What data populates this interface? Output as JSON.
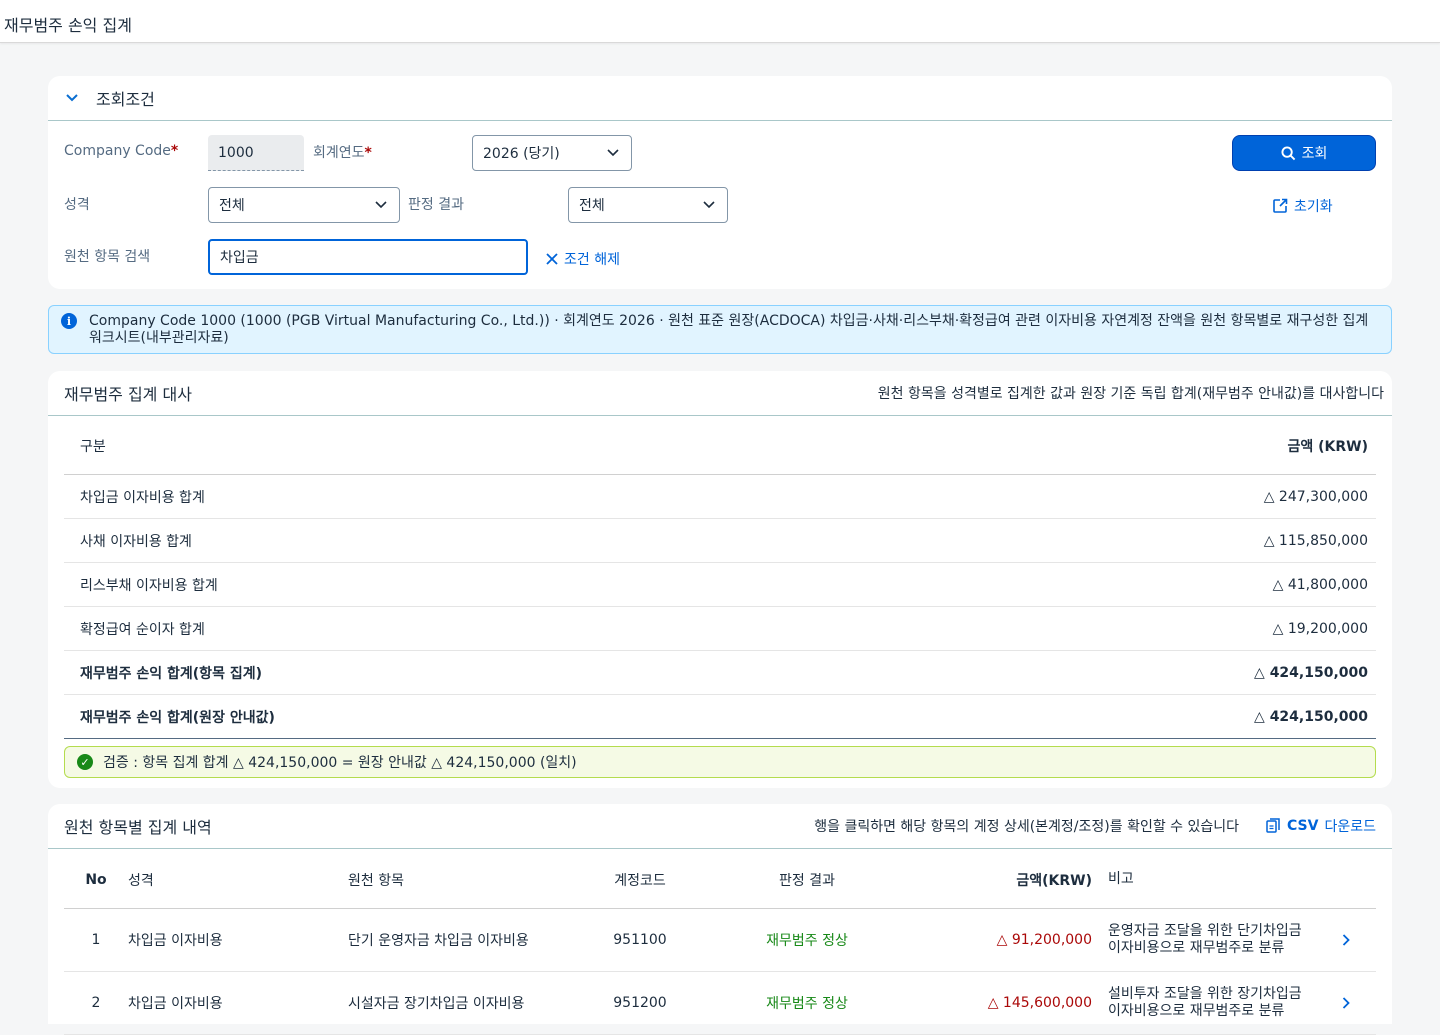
{
  "page": {
    "title": "재무범주 손익 집계"
  },
  "filter": {
    "title": "조회조건",
    "company_code_label": "Company Code",
    "company_code_value": "1000",
    "fiscal_year_label": "회계연도",
    "fiscal_year_value": "2026 (당기)",
    "nature_label": "성격",
    "nature_value": "전체",
    "judgment_label": "판정 결과",
    "judgment_value": "전체",
    "search_label": "원천 항목 검색",
    "search_value": "차입금",
    "clear_label": "조건 해제",
    "search_button": "조회",
    "reset_button": "초기화",
    "required_mark": "*"
  },
  "info": {
    "text": "Company Code 1000 (1000 (PGB Virtual Manufacturing Co., Ltd.)) · 회계연도 2026 · 원천 표준 원장(ACDOCA) 차입금·사채·리스부채·확정급여 관련 이자비용 자연계정 잔액을 원천 항목별로 재구성한 집계 워크시트(내부관리자료)"
  },
  "summary": {
    "title": "재무범주 집계 대사",
    "subtitle": "원천 항목을 성격별로 집계한 값과 원장 기준 독립 합계(재무범주 안내값)를 대사합니다",
    "col_label": "구분",
    "col_amount": "금액 (KRW)",
    "rows": [
      {
        "label": "차입금 이자비용 합계",
        "amount": "△ 247,300,000"
      },
      {
        "label": "사채 이자비용 합계",
        "amount": "△ 115,850,000"
      },
      {
        "label": "리스부채 이자비용 합계",
        "amount": "△ 41,800,000"
      },
      {
        "label": "확정급여 순이자 합계",
        "amount": "△ 19,200,000"
      },
      {
        "label": "재무범주 손익 합계(항목 집계)",
        "amount": "△ 424,150,000"
      },
      {
        "label": "재무범주 손익 합계(원장 안내값)",
        "amount": "△ 424,150,000"
      }
    ],
    "validation": "검증 : 항목 집계 합계 △ 424,150,000 = 원장 안내값 △ 424,150,000 (일치)"
  },
  "detail": {
    "title": "원천 항목별 집계 내역",
    "hint": "행을 클릭하면 해당 항목의 계정 상세(본계정/조정)를 확인할 수 있습니다",
    "csv_bold": "CSV",
    "csv_label": "다운로드",
    "columns": [
      "No",
      "성격",
      "원천 항목",
      "계정코드",
      "판정 결과",
      "금액(KRW)",
      "비고"
    ],
    "rows": [
      {
        "no": "1",
        "nature": "차입금 이자비용",
        "item": "단기 운영자금 차입금 이자비용",
        "code": "951100",
        "result": "재무범주 정상",
        "amount": "△ 91,200,000",
        "note": "운영자금 조달을 위한 단기차입금 이자비용으로 재무범주로 분류"
      },
      {
        "no": "2",
        "nature": "차입금 이자비용",
        "item": "시설자금 장기차입금 이자비용",
        "code": "951200",
        "result": "재무범주 정상",
        "amount": "△ 145,600,000",
        "note": "설비투자 조달을 위한 장기차입금 이자비용으로 재무범주로 분류"
      }
    ]
  },
  "colors": {
    "accent": "#0064d9",
    "positive": "#188918",
    "negative": "#aa0808"
  }
}
